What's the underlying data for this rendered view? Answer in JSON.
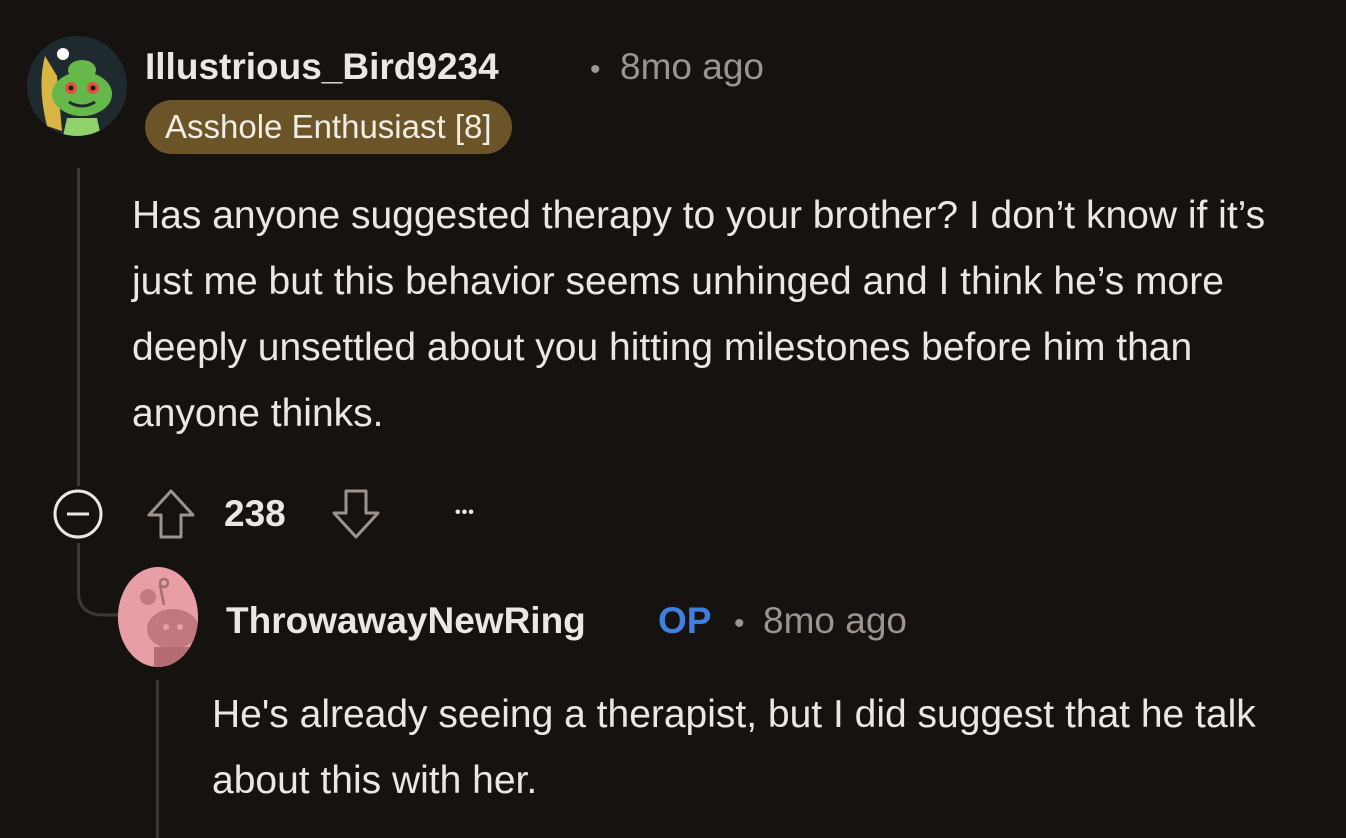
{
  "comments": [
    {
      "username": "Illustrious_Bird9234",
      "separator": "•",
      "timestamp": "8mo ago",
      "flair": "Asshole Enthusiast [8]",
      "body": "Has anyone suggested therapy to your brother? I don’t know if it’s just me but this behavior seems unhinged and I think he’s more deeply unsettled about you hitting milestones before him than anyone thinks.",
      "vote_count": "238",
      "more_label": "•••",
      "avatar_icon": "snoo-avatar-green",
      "collapse_icon": "collapse-minus-icon",
      "upvote_icon": "upvote-arrow-icon",
      "downvote_icon": "downvote-arrow-icon",
      "colors": {
        "flair_bg": "#6b5528",
        "avatar_bg": "#1f2a2f",
        "avatar_snoo": "#67b84a"
      }
    },
    {
      "username": "ThrowawayNewRing",
      "op_badge": "OP",
      "separator": "•",
      "timestamp": "8mo ago",
      "body": "He's already seeing a therapist, but I did suggest that he talk about this with her.",
      "avatar_icon": "snoo-avatar-pink",
      "colors": {
        "avatar_bg": "#e79ea6",
        "op_color": "#3f7fe0"
      }
    }
  ],
  "theme": {
    "background": "#161210",
    "thread_line": "#3d3835",
    "text": "#ece7e2",
    "meta": "#9c948d"
  }
}
